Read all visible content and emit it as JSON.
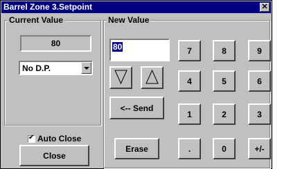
{
  "window": {
    "title": "Barrel Zone 3.Setpoint",
    "close_label": "✕"
  },
  "current_value": {
    "legend": "Current Value",
    "value": "80",
    "dp_selected": "No D.P.",
    "auto_close_label": "Auto Close",
    "auto_close_checked": true,
    "close_label": "Close"
  },
  "new_value": {
    "legend": "New Value",
    "entry_value": "80",
    "send_label": "<-- Send",
    "erase_label": "Erase",
    "keys": {
      "k7": "7",
      "k8": "8",
      "k9": "9",
      "k4": "4",
      "k5": "5",
      "k6": "6",
      "k1": "1",
      "k2": "2",
      "k3": "3",
      "kdot": ".",
      "k0": "0",
      "ksign": "+/-"
    }
  }
}
